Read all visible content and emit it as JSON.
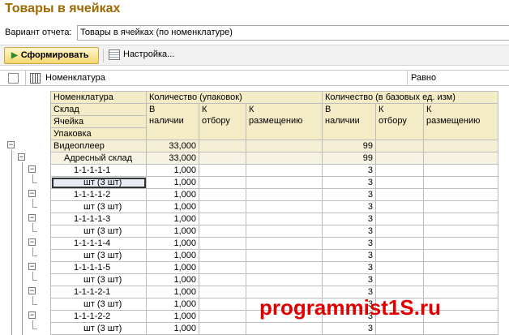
{
  "window": {
    "title": "Товары в ячейках"
  },
  "variant": {
    "label": "Вариант отчета:",
    "value": "Товары в ячейках (по номенклатуре)"
  },
  "toolbar": {
    "generate_label": "Сформировать",
    "settings_label": "Настройка..."
  },
  "filter": {
    "field": "Номенклатура",
    "condition": "Равно"
  },
  "report": {
    "header": {
      "dims": [
        "Номенклатура",
        "Склад",
        "Ячейка",
        "Упаковка"
      ],
      "group_pack": "Количество (упаковок)",
      "group_base": "Количество (в базовых ед. изм)",
      "sub": [
        [
          "В",
          "наличии"
        ],
        [
          "К",
          "отбору"
        ],
        [
          "К",
          "размещению"
        ]
      ]
    },
    "rows": [
      {
        "label": "Видеоплеер",
        "pack": "33,000",
        "base": "99",
        "level": 0,
        "box": "−"
      },
      {
        "label": "Адресный склад",
        "pack": "33,000",
        "base": "99",
        "level": 1,
        "box": "−"
      },
      {
        "label": "1-1-1-1-1",
        "pack": "1,000",
        "base": "3",
        "level": 2,
        "box": "−"
      },
      {
        "label": "шт (3 шт)",
        "pack": "1,000",
        "base": "3",
        "level": 3,
        "selected": true
      },
      {
        "label": "1-1-1-1-2",
        "pack": "1,000",
        "base": "3",
        "level": 2,
        "box": "−"
      },
      {
        "label": "шт (3 шт)",
        "pack": "1,000",
        "base": "3",
        "level": 3
      },
      {
        "label": "1-1-1-1-3",
        "pack": "1,000",
        "base": "3",
        "level": 2,
        "box": "−"
      },
      {
        "label": "шт (3 шт)",
        "pack": "1,000",
        "base": "3",
        "level": 3
      },
      {
        "label": "1-1-1-1-4",
        "pack": "1,000",
        "base": "3",
        "level": 2,
        "box": "−"
      },
      {
        "label": "шт (3 шт)",
        "pack": "1,000",
        "base": "3",
        "level": 3
      },
      {
        "label": "1-1-1-1-5",
        "pack": "1,000",
        "base": "3",
        "level": 2,
        "box": "−"
      },
      {
        "label": "шт (3 шт)",
        "pack": "1,000",
        "base": "3",
        "level": 3
      },
      {
        "label": "1-1-1-2-1",
        "pack": "1,000",
        "base": "3",
        "level": 2,
        "box": "−"
      },
      {
        "label": "шт (3 шт)",
        "pack": "1,000",
        "base": "3",
        "level": 3
      },
      {
        "label": "1-1-1-2-2",
        "pack": "1,000",
        "base": "3",
        "level": 2,
        "box": "−"
      },
      {
        "label": "шт (3 шт)",
        "pack": "1,000",
        "base": "3",
        "level": 3
      }
    ]
  },
  "watermark": "programmist1S.ru",
  "colors": {
    "title": "#a06800",
    "header_bg": "#f4ecc7",
    "watermark": "#e00000"
  }
}
